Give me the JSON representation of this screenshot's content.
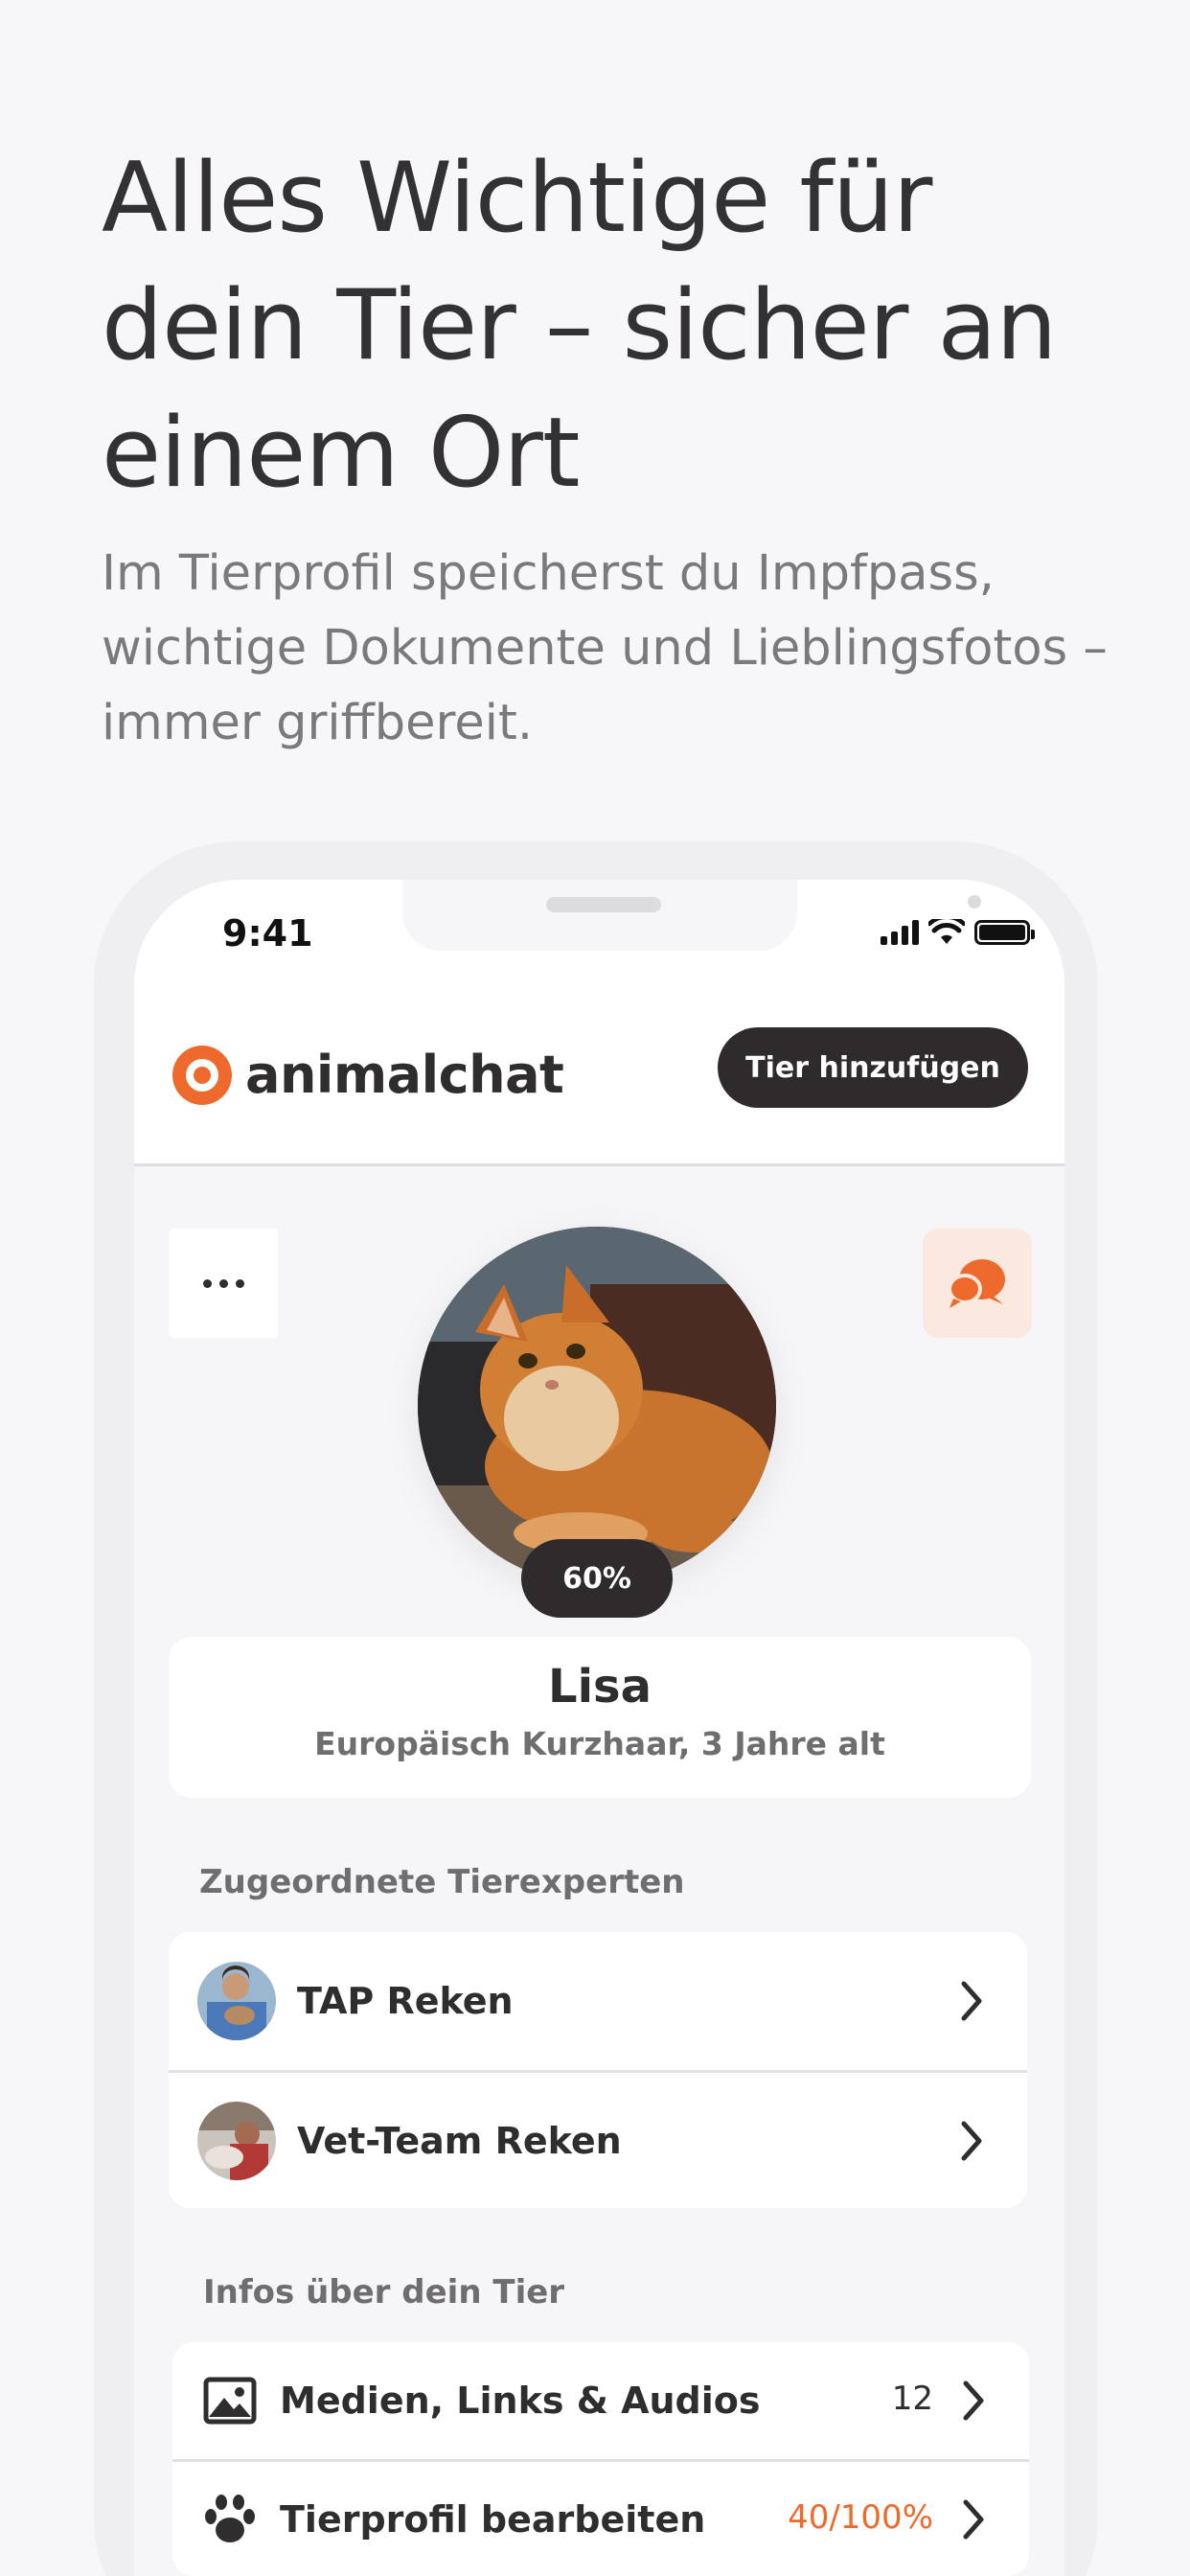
{
  "headline": "Alles Wichtige für dein Tier – sicher an einem Ort",
  "subline": "Im Tierprofil speicherst du Impfpass, wichtige Dokumente und Lieblingsfotos – immer griffbereit.",
  "status_bar": {
    "time": "9:41"
  },
  "app": {
    "name": "animalchat",
    "add_pet_label": "Tier hinzufügen"
  },
  "pet": {
    "profile_progress": "60%",
    "name": "Lisa",
    "description": "Europäisch Kurzhaar, 3 Jahre alt"
  },
  "experts": {
    "heading": "Zugeordnete Tierexperten",
    "items": [
      {
        "label": "TAP Reken"
      },
      {
        "label": "Vet-Team Reken"
      }
    ]
  },
  "infos": {
    "heading": "Infos über dein Tier",
    "items": [
      {
        "label": "Medien, Links & Audios",
        "count": "12",
        "icon": "image-icon"
      },
      {
        "label": "Tierprofil bearbeiten",
        "count": "40/100%",
        "icon": "paw-icon"
      }
    ]
  },
  "colors": {
    "accent": "#ee6a2c",
    "dark": "#2f2b2c",
    "background": "#f7f7fa"
  }
}
